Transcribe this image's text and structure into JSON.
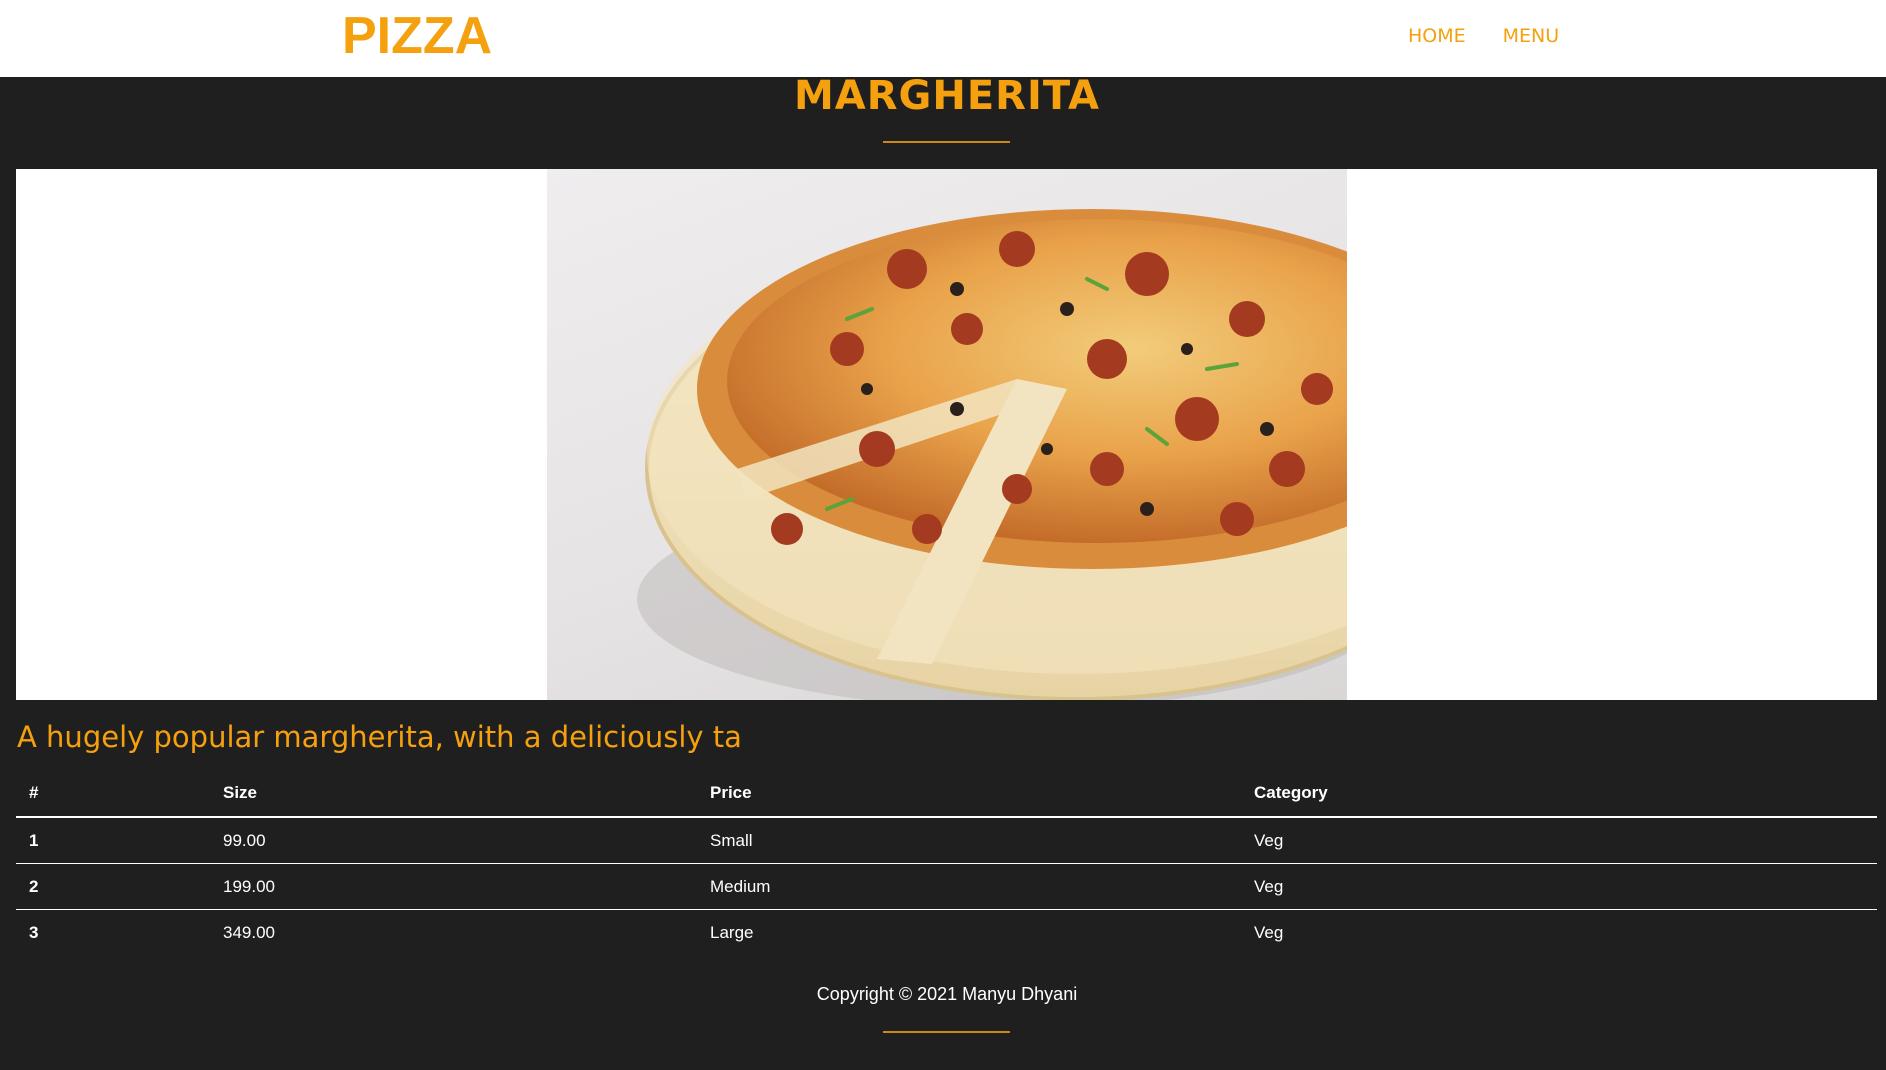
{
  "navbar": {
    "brand": "PIZZA",
    "links": [
      "HOME",
      "MENU"
    ]
  },
  "product": {
    "title": "MARGHERITA",
    "description": "A hugely popular margherita, with a deliciously ta",
    "image_icon": "pizza-photo"
  },
  "table": {
    "headers": [
      "#",
      "Size",
      "Price",
      "Category"
    ],
    "rows": [
      [
        "1",
        "99.00",
        "Small",
        "Veg"
      ],
      [
        "2",
        "199.00",
        "Medium",
        "Veg"
      ],
      [
        "3",
        "349.00",
        "Large",
        "Veg"
      ]
    ]
  },
  "footer": {
    "copyright": "Copyright © 2021 Manyu Dhyani"
  },
  "colors": {
    "accent": "#f5a00e",
    "background": "#1f1f1f",
    "navbar": "#ffffff"
  }
}
